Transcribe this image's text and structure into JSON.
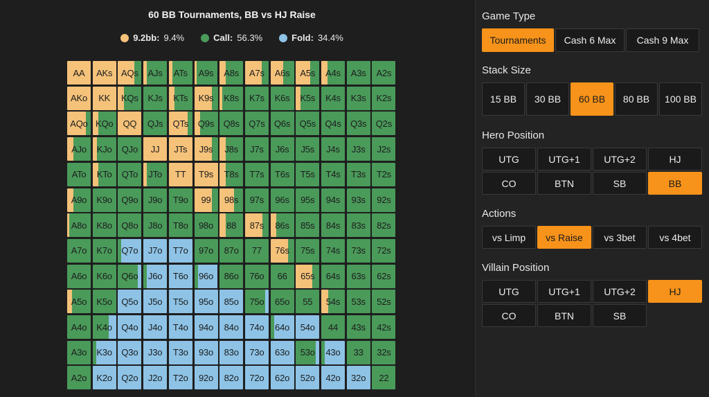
{
  "header": {
    "title": "60 BB Tournaments, BB vs HJ Raise"
  },
  "legend": [
    {
      "label": "9.2bb:",
      "value": "9.4%",
      "color": "#f5c27a"
    },
    {
      "label": "Call:",
      "value": "56.3%",
      "color": "#4a9a5a"
    },
    {
      "label": "Fold:",
      "value": "34.4%",
      "color": "#8ec3e6"
    }
  ],
  "colors": {
    "raise": "#f5c27a",
    "call": "#4a9a5a",
    "fold": "#8ec3e6",
    "accent": "#f7931a"
  },
  "grid": {
    "rows": [
      [
        [
          "AA",
          100,
          0
        ],
        [
          "AKs",
          100,
          0
        ],
        [
          "AQs",
          70,
          30
        ],
        [
          "AJs",
          15,
          85
        ],
        [
          "ATs",
          15,
          85
        ],
        [
          "A9s",
          10,
          90
        ],
        [
          "A8s",
          25,
          75
        ],
        [
          "A7s",
          70,
          30
        ],
        [
          "A6s",
          55,
          45
        ],
        [
          "A5s",
          60,
          40
        ],
        [
          "A4s",
          25,
          75
        ],
        [
          "A3s",
          0,
          100
        ],
        [
          "A2s",
          0,
          100
        ]
      ],
      [
        [
          "AKo",
          100,
          0
        ],
        [
          "KK",
          100,
          0
        ],
        [
          "KQs",
          25,
          75
        ],
        [
          "KJs",
          0,
          100
        ],
        [
          "KTs",
          25,
          75
        ],
        [
          "K9s",
          75,
          25
        ],
        [
          "K8s",
          10,
          90
        ],
        [
          "K7s",
          0,
          100
        ],
        [
          "K6s",
          0,
          100
        ],
        [
          "K5s",
          20,
          80
        ],
        [
          "K4s",
          0,
          100
        ],
        [
          "K3s",
          0,
          100
        ],
        [
          "K2s",
          0,
          100
        ]
      ],
      [
        [
          "AQo",
          80,
          20
        ],
        [
          "KQo",
          25,
          75
        ],
        [
          "QQ",
          100,
          0
        ],
        [
          "QJs",
          0,
          100
        ],
        [
          "QTs",
          80,
          20
        ],
        [
          "Q9s",
          25,
          75
        ],
        [
          "Q8s",
          0,
          100
        ],
        [
          "Q7s",
          0,
          100
        ],
        [
          "Q6s",
          0,
          100
        ],
        [
          "Q5s",
          0,
          100
        ],
        [
          "Q4s",
          0,
          100
        ],
        [
          "Q3s",
          0,
          100
        ],
        [
          "Q2s",
          0,
          100
        ]
      ],
      [
        [
          "AJo",
          25,
          75
        ],
        [
          "KJo",
          20,
          80
        ],
        [
          "QJo",
          0,
          100
        ],
        [
          "JJ",
          100,
          0
        ],
        [
          "JTs",
          100,
          0
        ],
        [
          "J9s",
          75,
          25
        ],
        [
          "J8s",
          25,
          75
        ],
        [
          "J7s",
          0,
          100
        ],
        [
          "J6s",
          0,
          100
        ],
        [
          "J5s",
          0,
          100
        ],
        [
          "J4s",
          0,
          100
        ],
        [
          "J3s",
          0,
          100
        ],
        [
          "J2s",
          0,
          100
        ]
      ],
      [
        [
          "ATo",
          0,
          100
        ],
        [
          "KTo",
          25,
          75
        ],
        [
          "QTo",
          0,
          100
        ],
        [
          "JTo",
          15,
          85
        ],
        [
          "TT",
          100,
          0
        ],
        [
          "T9s",
          100,
          0
        ],
        [
          "T8s",
          25,
          75
        ],
        [
          "T7s",
          0,
          100
        ],
        [
          "T6s",
          0,
          100
        ],
        [
          "T5s",
          0,
          100
        ],
        [
          "T4s",
          0,
          100
        ],
        [
          "T3s",
          0,
          100
        ],
        [
          "T2s",
          0,
          100
        ]
      ],
      [
        [
          "A9o",
          25,
          75
        ],
        [
          "K9o",
          0,
          100
        ],
        [
          "Q9o",
          0,
          100
        ],
        [
          "J9o",
          0,
          100
        ],
        [
          "T9o",
          0,
          100
        ],
        [
          "99",
          75,
          25
        ],
        [
          "98s",
          60,
          40
        ],
        [
          "97s",
          0,
          100
        ],
        [
          "96s",
          0,
          100
        ],
        [
          "95s",
          0,
          100
        ],
        [
          "94s",
          0,
          100
        ],
        [
          "93s",
          0,
          100
        ],
        [
          "92s",
          0,
          100
        ]
      ],
      [
        [
          "A8o",
          10,
          90
        ],
        [
          "K8o",
          0,
          100
        ],
        [
          "Q8o",
          0,
          100
        ],
        [
          "J8o",
          0,
          100
        ],
        [
          "T8o",
          0,
          100
        ],
        [
          "98o",
          0,
          100
        ],
        [
          "88",
          25,
          75
        ],
        [
          "87s",
          75,
          25
        ],
        [
          "86s",
          25,
          75
        ],
        [
          "85s",
          0,
          100
        ],
        [
          "84s",
          0,
          100
        ],
        [
          "83s",
          0,
          100
        ],
        [
          "82s",
          0,
          100
        ]
      ],
      [
        [
          "A7o",
          0,
          100
        ],
        [
          "K7o",
          0,
          100
        ],
        [
          "Q7o",
          0,
          15
        ],
        [
          "J7o",
          0,
          0
        ],
        [
          "T7o",
          0,
          0
        ],
        [
          "97o",
          0,
          100
        ],
        [
          "87o",
          0,
          100
        ],
        [
          "77",
          0,
          100
        ],
        [
          "76s",
          75,
          25
        ],
        [
          "75s",
          0,
          100
        ],
        [
          "74s",
          0,
          100
        ],
        [
          "73s",
          0,
          100
        ],
        [
          "72s",
          0,
          100
        ]
      ],
      [
        [
          "A6o",
          0,
          100
        ],
        [
          "K6o",
          0,
          100
        ],
        [
          "Q6o",
          0,
          85
        ],
        [
          "J6o",
          0,
          15
        ],
        [
          "T6o",
          0,
          0
        ],
        [
          "96o",
          0,
          15
        ],
        [
          "86o",
          0,
          100
        ],
        [
          "76o",
          0,
          100
        ],
        [
          "66",
          0,
          100
        ],
        [
          "65s",
          70,
          30
        ],
        [
          "64s",
          0,
          100
        ],
        [
          "63s",
          0,
          100
        ],
        [
          "62s",
          0,
          100
        ]
      ],
      [
        [
          "A5o",
          20,
          80
        ],
        [
          "K5o",
          0,
          100
        ],
        [
          "Q5o",
          0,
          0
        ],
        [
          "J5o",
          0,
          0
        ],
        [
          "T5o",
          0,
          0
        ],
        [
          "95o",
          0,
          0
        ],
        [
          "85o",
          0,
          0
        ],
        [
          "75o",
          0,
          85
        ],
        [
          "65o",
          0,
          100
        ],
        [
          "55",
          0,
          100
        ],
        [
          "54s",
          30,
          70
        ],
        [
          "53s",
          0,
          100
        ],
        [
          "52s",
          0,
          100
        ]
      ],
      [
        [
          "A4o",
          0,
          100
        ],
        [
          "K4o",
          0,
          70
        ],
        [
          "Q4o",
          0,
          0
        ],
        [
          "J4o",
          0,
          0
        ],
        [
          "T4o",
          0,
          0
        ],
        [
          "94o",
          0,
          0
        ],
        [
          "84o",
          0,
          0
        ],
        [
          "74o",
          0,
          0
        ],
        [
          "64o",
          0,
          15
        ],
        [
          "54o",
          0,
          0
        ],
        [
          "44",
          0,
          100
        ],
        [
          "43s",
          0,
          100
        ],
        [
          "42s",
          0,
          100
        ]
      ],
      [
        [
          "A3o",
          0,
          100
        ],
        [
          "K3o",
          0,
          15
        ],
        [
          "Q3o",
          0,
          0
        ],
        [
          "J3o",
          0,
          0
        ],
        [
          "T3o",
          0,
          0
        ],
        [
          "93o",
          0,
          0
        ],
        [
          "83o",
          0,
          0
        ],
        [
          "73o",
          0,
          0
        ],
        [
          "63o",
          0,
          0
        ],
        [
          "53o",
          0,
          85
        ],
        [
          "43o",
          0,
          15
        ],
        [
          "33",
          0,
          100
        ],
        [
          "32s",
          0,
          100
        ]
      ],
      [
        [
          "A2o",
          0,
          100
        ],
        [
          "K2o",
          0,
          0
        ],
        [
          "Q2o",
          0,
          0
        ],
        [
          "J2o",
          0,
          0
        ],
        [
          "T2o",
          0,
          0
        ],
        [
          "92o",
          0,
          0
        ],
        [
          "82o",
          0,
          0
        ],
        [
          "72o",
          0,
          0
        ],
        [
          "62o",
          0,
          0
        ],
        [
          "52o",
          0,
          0
        ],
        [
          "42o",
          0,
          0
        ],
        [
          "32o",
          0,
          0
        ],
        [
          "22",
          0,
          100
        ]
      ]
    ]
  },
  "panel": {
    "game_type": {
      "title": "Game Type",
      "options": [
        "Tournaments",
        "Cash 6 Max",
        "Cash 9 Max"
      ],
      "active": 0
    },
    "stack_size": {
      "title": "Stack Size",
      "options": [
        "15 BB",
        "30 BB",
        "60 BB",
        "80 BB",
        "100 BB"
      ],
      "active": 2
    },
    "hero_position": {
      "title": "Hero Position",
      "options": [
        "UTG",
        "UTG+1",
        "UTG+2",
        "HJ",
        "CO",
        "BTN",
        "SB",
        "BB"
      ],
      "active": 7
    },
    "actions": {
      "title": "Actions",
      "options": [
        "vs Limp",
        "vs Raise",
        "vs 3bet",
        "vs 4bet"
      ],
      "active": 1
    },
    "villain_position": {
      "title": "Villain Position",
      "options": [
        "UTG",
        "UTG+1",
        "UTG+2",
        "HJ",
        "CO",
        "BTN",
        "SB"
      ],
      "active": 3
    }
  }
}
